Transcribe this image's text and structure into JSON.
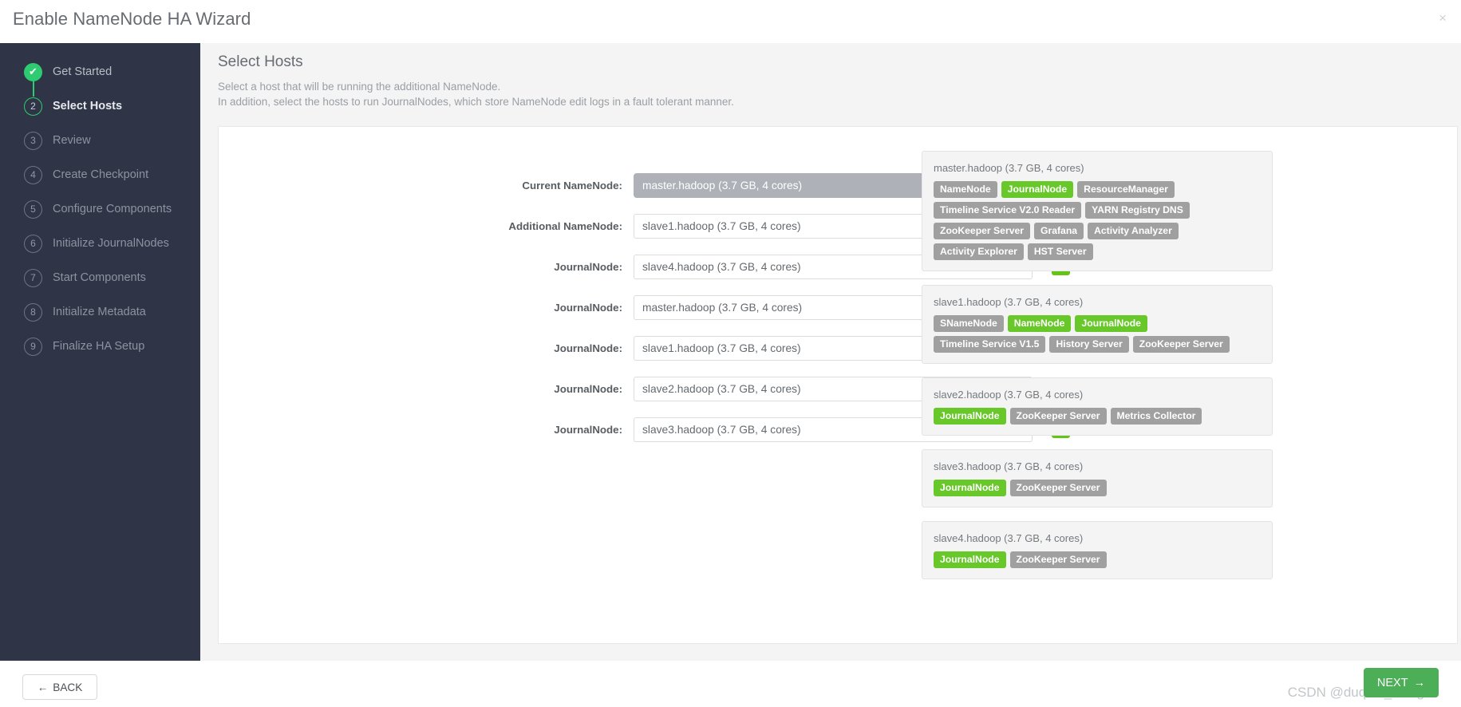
{
  "window": {
    "title": "Enable NameNode HA Wizard",
    "close_icon": "close-icon",
    "close_glyph": "×"
  },
  "sidebar": {
    "steps": [
      {
        "num": "✔",
        "label": "Get Started",
        "state": "done"
      },
      {
        "num": "2",
        "label": "Select Hosts",
        "state": "active"
      },
      {
        "num": "3",
        "label": "Review",
        "state": "pending"
      },
      {
        "num": "4",
        "label": "Create Checkpoint",
        "state": "pending"
      },
      {
        "num": "5",
        "label": "Configure Components",
        "state": "pending"
      },
      {
        "num": "6",
        "label": "Initialize JournalNodes",
        "state": "pending"
      },
      {
        "num": "7",
        "label": "Start Components",
        "state": "pending"
      },
      {
        "num": "8",
        "label": "Initialize Metadata",
        "state": "pending"
      },
      {
        "num": "9",
        "label": "Finalize HA Setup",
        "state": "pending"
      }
    ]
  },
  "main": {
    "title": "Select Hosts",
    "desc_line1": "Select a host that will be running the additional NameNode.",
    "desc_line2": "In addition, select the hosts to run JournalNodes, which store NameNode edit logs in a fault tolerant manner.",
    "rows": [
      {
        "label": "Current NameNode:",
        "value": "master.hadoop (3.7 GB, 4 cores)",
        "disabled": true,
        "minus": false
      },
      {
        "label": "Additional NameNode:",
        "value": "slave1.hadoop (3.7 GB, 4 cores)",
        "disabled": false,
        "minus": false
      },
      {
        "label": "JournalNode:",
        "value": "slave4.hadoop (3.7 GB, 4 cores)",
        "disabled": false,
        "minus": true
      },
      {
        "label": "JournalNode:",
        "value": "master.hadoop (3.7 GB, 4 cores)",
        "disabled": false,
        "minus": true
      },
      {
        "label": "JournalNode:",
        "value": "slave1.hadoop (3.7 GB, 4 cores)",
        "disabled": false,
        "minus": true
      },
      {
        "label": "JournalNode:",
        "value": "slave2.hadoop (3.7 GB, 4 cores)",
        "disabled": false,
        "minus": true
      },
      {
        "label": "JournalNode:",
        "value": "slave3.hadoop (3.7 GB, 4 cores)",
        "disabled": false,
        "minus": true
      }
    ],
    "hosts": [
      {
        "name": "master.hadoop (3.7 GB, 4 cores)",
        "components": [
          {
            "label": "NameNode",
            "active": false
          },
          {
            "label": "JournalNode",
            "active": true
          },
          {
            "label": "ResourceManager",
            "active": false
          },
          {
            "label": "Timeline Service V2.0 Reader",
            "active": false
          },
          {
            "label": "YARN Registry DNS",
            "active": false
          },
          {
            "label": "ZooKeeper Server",
            "active": false
          },
          {
            "label": "Grafana",
            "active": false
          },
          {
            "label": "Activity Analyzer",
            "active": false
          },
          {
            "label": "Activity Explorer",
            "active": false
          },
          {
            "label": "HST Server",
            "active": false
          }
        ]
      },
      {
        "name": "slave1.hadoop (3.7 GB, 4 cores)",
        "components": [
          {
            "label": "SNameNode",
            "active": false
          },
          {
            "label": "NameNode",
            "active": true
          },
          {
            "label": "JournalNode",
            "active": true
          },
          {
            "label": "Timeline Service V1.5",
            "active": false
          },
          {
            "label": "History Server",
            "active": false
          },
          {
            "label": "ZooKeeper Server",
            "active": false
          }
        ]
      },
      {
        "name": "slave2.hadoop (3.7 GB, 4 cores)",
        "components": [
          {
            "label": "JournalNode",
            "active": true
          },
          {
            "label": "ZooKeeper Server",
            "active": false
          },
          {
            "label": "Metrics Collector",
            "active": false
          }
        ]
      },
      {
        "name": "slave3.hadoop (3.7 GB, 4 cores)",
        "components": [
          {
            "label": "JournalNode",
            "active": true
          },
          {
            "label": "ZooKeeper Server",
            "active": false
          }
        ]
      },
      {
        "name": "slave4.hadoop (3.7 GB, 4 cores)",
        "components": [
          {
            "label": "JournalNode",
            "active": true
          },
          {
            "label": "ZooKeeper Server",
            "active": false
          }
        ]
      }
    ]
  },
  "footer": {
    "back_label": "BACK",
    "back_arrow": "←",
    "next_label": "NEXT",
    "next_arrow": "→",
    "watermark": "CSDN @duqiao_wang"
  },
  "colors": {
    "accent_green": "#2ecc71",
    "tag_green": "#68c82a",
    "minus_green": "#63c416",
    "next_green": "#4cae56",
    "sidebar_bg": "#2f3546",
    "tag_grey": "#a0a0a0"
  }
}
